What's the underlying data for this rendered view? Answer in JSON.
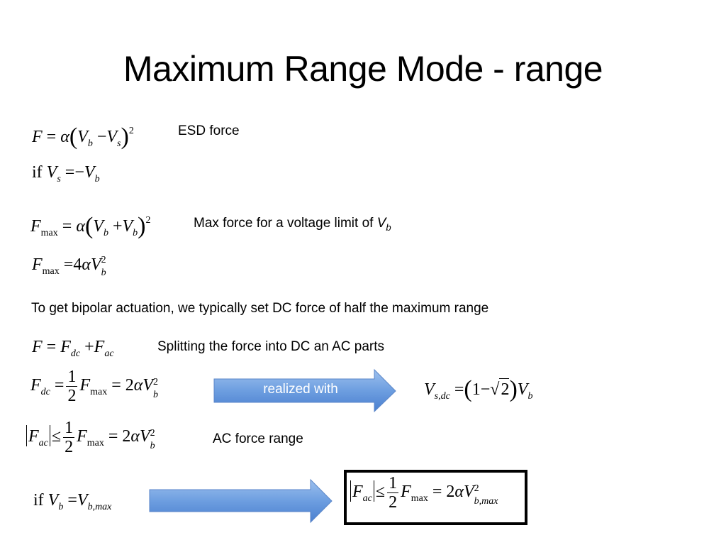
{
  "slide": {
    "title": "Maximum Range Mode - range",
    "labels": {
      "esd_force": "ESD force",
      "max_force": "Max force for a voltage limit of ",
      "max_force_var": "V",
      "max_force_var_sub": "b",
      "bipolar": "To get bipolar actuation, we typically set DC force of half the maximum range",
      "splitting": "Splitting the force into  DC an AC parts",
      "ac_force_range": "AC force range"
    },
    "arrows": {
      "realized_with": "realized with"
    },
    "colors": {
      "arrow_top": "#8db4ea",
      "arrow_bottom": "#4a7fcf",
      "arrow_border": "#3f6fb8"
    },
    "equations": {
      "esd": "F = α(V_b − V_s)^2",
      "condition": "if V_s = −V_b",
      "fmax_sum": "F_max = α(V_b + V_b)^2",
      "fmax": "F_max = 4αV_b^2",
      "split": "F = F_dc + F_ac",
      "fdc": "F_dc = (1/2) F_max = 2αV_b^2",
      "vsdc": "V_s,dc = (1 − √2) V_b",
      "fac": "|F_ac| ≤ (1/2) F_max = 2αV_b^2",
      "condition_max": "if V_b = V_b,max",
      "result": "|F_ac| ≤ (1/2) F_max = 2αV_b,max^2"
    },
    "sym": {
      "F": "F",
      "V": "V",
      "alpha": "α",
      "eq": "=",
      "minus": "−",
      "plus": "+",
      "le": "≤",
      "two": "2",
      "one": "1",
      "four": "4",
      "if": "if",
      "b": "b",
      "s": "s",
      "max": "max",
      "dc": "dc",
      "ac": "ac",
      "sdc": "s,dc",
      "bmax": "b,max",
      "lp": "(",
      "rp": ")",
      "sqrt": "√"
    }
  }
}
